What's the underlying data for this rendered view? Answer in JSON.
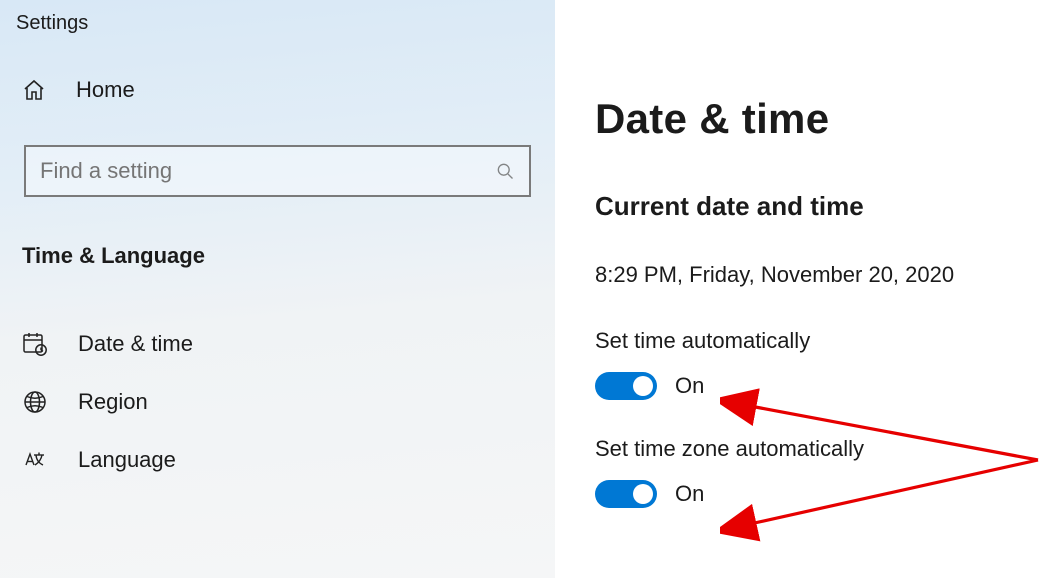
{
  "header": "Settings",
  "home_label": "Home",
  "search": {
    "placeholder": "Find a setting"
  },
  "category": "Time & Language",
  "nav": {
    "date_time": "Date & time",
    "region": "Region",
    "language": "Language"
  },
  "main": {
    "title": "Date & time",
    "section": "Current date and time",
    "current": "8:29 PM, Friday, November 20, 2020",
    "set_time_label": "Set time automatically",
    "set_time_state": "On",
    "set_tz_label": "Set time zone automatically",
    "set_tz_state": "On"
  },
  "colors": {
    "accent": "#0078d4",
    "arrow": "#e60000"
  }
}
